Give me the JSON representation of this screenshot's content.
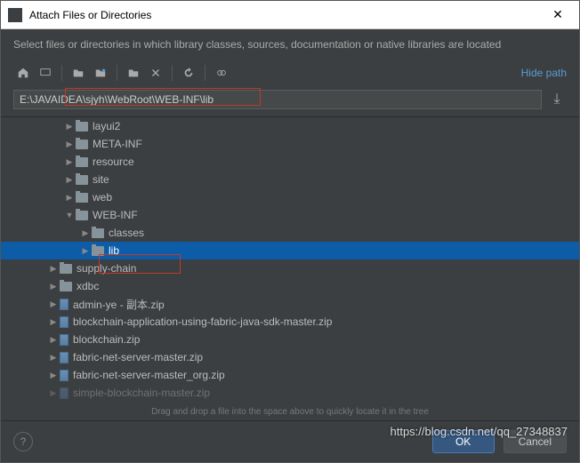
{
  "titlebar": {
    "title": "Attach Files or Directories",
    "close": "✕"
  },
  "subtitle": "Select files or directories in which library classes, sources, documentation or native libraries are located",
  "toolbar": {
    "hide_path": "Hide path"
  },
  "path": {
    "value": "E:\\JAVAIDEA\\sjyh\\WebRoot\\WEB-INF\\lib",
    "save_glyph": "⤓"
  },
  "tree": [
    {
      "indent": 72,
      "arrow": "▶",
      "type": "folder",
      "label": "layui2"
    },
    {
      "indent": 72,
      "arrow": "▶",
      "type": "folder",
      "label": "META-INF"
    },
    {
      "indent": 72,
      "arrow": "▶",
      "type": "folder",
      "label": "resource"
    },
    {
      "indent": 72,
      "arrow": "▶",
      "type": "folder",
      "label": "site"
    },
    {
      "indent": 72,
      "arrow": "▶",
      "type": "folder",
      "label": "web"
    },
    {
      "indent": 72,
      "arrow": "▼",
      "type": "folder",
      "label": "WEB-INF"
    },
    {
      "indent": 90,
      "arrow": "▶",
      "type": "folder",
      "label": "classes"
    },
    {
      "indent": 90,
      "arrow": "▶",
      "type": "folder",
      "label": "lib",
      "selected": true
    },
    {
      "indent": 54,
      "arrow": "▶",
      "type": "folder",
      "label": "supply-chain"
    },
    {
      "indent": 54,
      "arrow": "▶",
      "type": "folder",
      "label": "xdbc"
    },
    {
      "indent": 54,
      "arrow": "▶",
      "type": "zip",
      "label": "admin-ye - 副本.zip"
    },
    {
      "indent": 54,
      "arrow": "▶",
      "type": "zip",
      "label": "blockchain-application-using-fabric-java-sdk-master.zip"
    },
    {
      "indent": 54,
      "arrow": "▶",
      "type": "zip",
      "label": "blockchain.zip"
    },
    {
      "indent": 54,
      "arrow": "▶",
      "type": "zip",
      "label": "fabric-net-server-master.zip"
    },
    {
      "indent": 54,
      "arrow": "▶",
      "type": "zip",
      "label": "fabric-net-server-master_org.zip"
    },
    {
      "indent": 54,
      "arrow": "▶",
      "type": "zip",
      "label": "simple-blockchain-master.zip",
      "cut": true
    }
  ],
  "drag_hint": "Drag and drop a file into the space above to quickly locate it in the tree",
  "footer": {
    "help": "?",
    "ok": "OK",
    "cancel": "Cancel"
  },
  "watermark": "https://blog.csdn.net/qq_27348837"
}
